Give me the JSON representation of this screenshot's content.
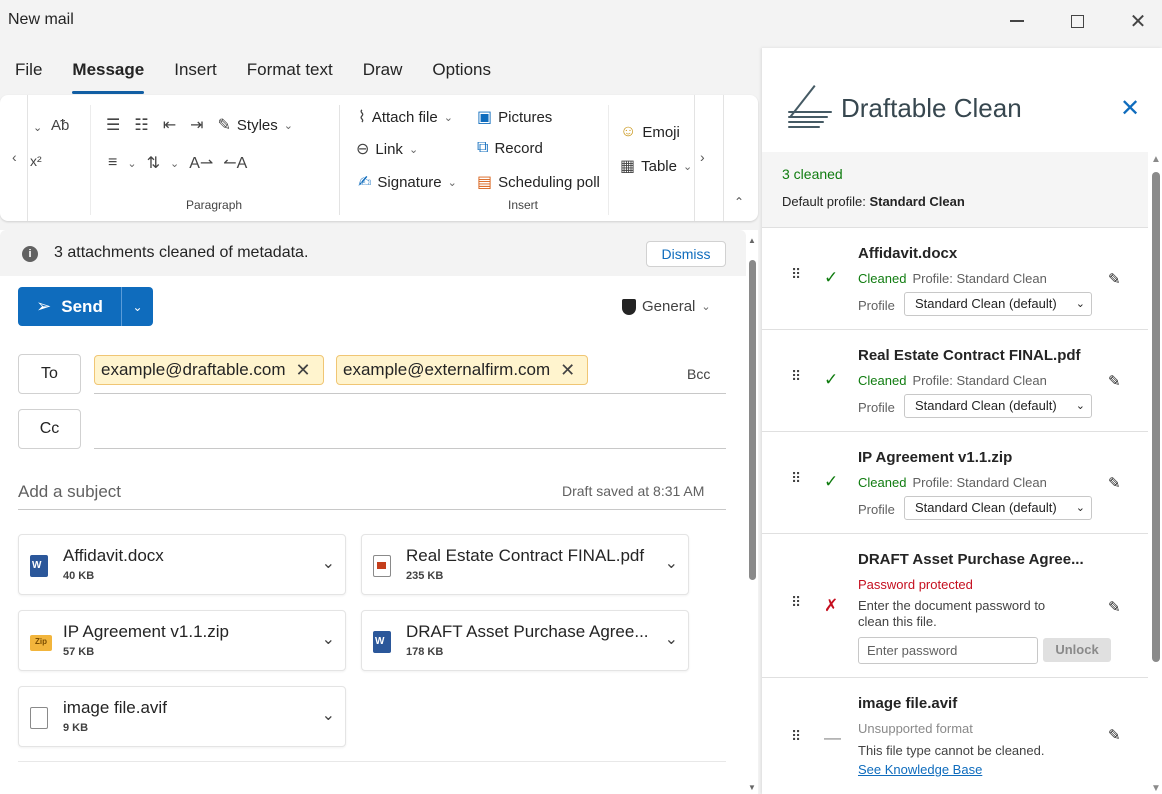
{
  "window": {
    "title": "New mail"
  },
  "menu": {
    "tabs": [
      "File",
      "Message",
      "Insert",
      "Format text",
      "Draw",
      "Options"
    ],
    "active": "Message"
  },
  "ribbon": {
    "styles_label": "Styles",
    "paragraph_label": "Paragraph",
    "attach_file_label": "Attach file",
    "link_label": "Link",
    "signature_label": "Signature",
    "pictures_label": "Pictures",
    "record_label": "Record",
    "scheduling_poll_label": "Scheduling poll",
    "insert_label": "Insert",
    "emoji_label": "Emoji",
    "table_label": "Table"
  },
  "infobar": {
    "message": "3 attachments cleaned of metadata.",
    "dismiss_label": "Dismiss"
  },
  "compose": {
    "send_label": "Send",
    "sensitivity_label": "General",
    "to_label": "To",
    "cc_label": "Cc",
    "bcc_label": "Bcc",
    "to_recipients": [
      "example@draftable.com",
      "example@externalfirm.com"
    ],
    "subject_placeholder": "Add a subject",
    "draft_saved": "Draft saved at 8:31 AM"
  },
  "attachments": [
    {
      "name": "Affidavit.docx",
      "size": "40 KB",
      "type": "word"
    },
    {
      "name": "Real Estate Contract FINAL.pdf",
      "size": "235 KB",
      "type": "pdf"
    },
    {
      "name": "IP Agreement v1.1.zip",
      "size": "57 KB",
      "type": "zip"
    },
    {
      "name": "DRAFT Asset Purchase Agree...",
      "size": "178 KB",
      "type": "word"
    },
    {
      "name": "image file.avif",
      "size": "9 KB",
      "type": "blank"
    }
  ],
  "panel": {
    "title": "Draftable Clean",
    "cleaned_count": "3 cleaned",
    "default_profile_label": "Default profile:",
    "default_profile_value": "Standard Clean",
    "files": [
      {
        "name": "Affidavit.docx",
        "state": "Cleaned",
        "profile_text": "Profile: Standard Clean",
        "profile_label": "Profile",
        "profile_select": "Standard Clean (default)"
      },
      {
        "name": "Real Estate Contract FINAL.pdf",
        "state": "Cleaned",
        "profile_text": "Profile: Standard Clean",
        "profile_label": "Profile",
        "profile_select": "Standard Clean (default)"
      },
      {
        "name": "IP Agreement v1.1.zip",
        "state": "Cleaned",
        "profile_text": "Profile: Standard Clean",
        "profile_label": "Profile",
        "profile_select": "Standard Clean (default)"
      },
      {
        "name": "DRAFT Asset Purchase Agree...",
        "state": "Password protected",
        "description": "Enter the document password to clean this file.",
        "password_placeholder": "Enter password",
        "unlock_label": "Unlock"
      },
      {
        "name": "image file.avif",
        "state": "Unsupported format",
        "description": "This file type cannot be cleaned.",
        "link_label": "See Knowledge Base"
      }
    ]
  },
  "colors": {
    "accent": "#0f6cbd",
    "success": "#107c10",
    "error": "#c50f1f",
    "chip_bg": "#fff4ce"
  }
}
